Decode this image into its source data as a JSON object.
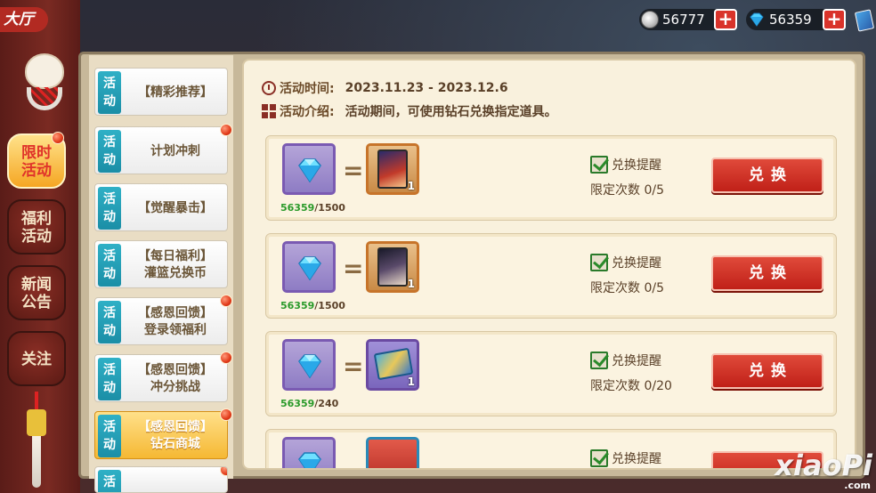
{
  "topbar": {
    "title": "大厅",
    "coins": "56777",
    "diamonds": "56359"
  },
  "categories": [
    {
      "label_1": "限时",
      "label_2": "活动",
      "active": true,
      "dot": true
    },
    {
      "label_1": "福利",
      "label_2": "活动",
      "active": false,
      "dot": false
    },
    {
      "label_1": "新闻",
      "label_2": "公告",
      "active": false,
      "dot": false
    },
    {
      "label_1": "关注",
      "label_2": "",
      "active": false,
      "dot": false
    }
  ],
  "activity_badge": {
    "line_1": "活",
    "line_2": "动"
  },
  "activities": [
    {
      "line_1": "【精彩推荐】",
      "line_2": ""
    },
    {
      "line_1": "计划冲刺",
      "line_2": ""
    },
    {
      "line_1": "【觉醒暴击】",
      "line_2": ""
    },
    {
      "line_1": "【每日福利】",
      "line_2": "灌篮兑换币"
    },
    {
      "line_1": "【感恩回馈】",
      "line_2": "登录领福利"
    },
    {
      "line_1": "【感恩回馈】",
      "line_2": "冲分挑战"
    },
    {
      "line_1": "【感恩回馈】",
      "line_2": "钻石商城"
    }
  ],
  "event": {
    "time_label": "活动时间:",
    "time_value": "2023.11.23 - 2023.12.6",
    "intro_label": "活动介绍:",
    "intro_value": "活动期间，可使用钻石兑换指定道具。"
  },
  "exchanges": [
    {
      "have": "56359",
      "cost": "/1500",
      "reward_count": "1",
      "remind": "兑换提醒",
      "limit": "限定次数 0/5",
      "button": "兑换"
    },
    {
      "have": "56359",
      "cost": "/1500",
      "reward_count": "1",
      "remind": "兑换提醒",
      "limit": "限定次数 0/5",
      "button": "兑换"
    },
    {
      "have": "56359",
      "cost": "/240",
      "reward_count": "1",
      "remind": "兑换提醒",
      "limit": "限定次数 0/20",
      "button": "兑换"
    },
    {
      "have": "",
      "cost": "",
      "reward_count": "",
      "remind": "兑换提醒",
      "limit": "",
      "button": ""
    }
  ],
  "watermark": {
    "main": "xiaoPi",
    "sub": ".com"
  },
  "colors": {
    "accent_red": "#c02018",
    "highlight_gold": "#f5b833",
    "activity_badge": "#1b8ea6"
  }
}
